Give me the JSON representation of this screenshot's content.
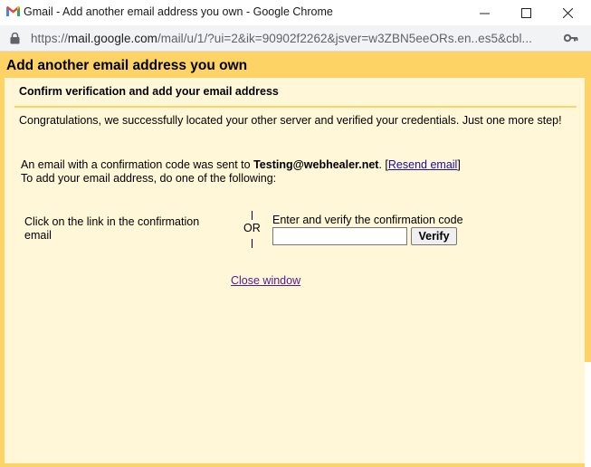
{
  "window": {
    "title": "Gmail - Add another email address you own - Google Chrome",
    "minimize": "—",
    "maximize": "☐",
    "close": "✕"
  },
  "addressbar": {
    "url_prefix": "https://",
    "url_host": "mail.google.com",
    "url_rest": "/mail/u/1/?ui=2&ik=90902f2262&jsver=w3ZBN5eeORs.en..es5&cbl..."
  },
  "page": {
    "title": "Add another email address you own",
    "section_title": "Confirm verification and add your email address",
    "congrats": "Congratulations, we successfully located your other server and verified your credentials. Just one more step!",
    "sent_prefix": "An email with a confirmation code was sent to ",
    "sent_email": "Testing@webhealer.net",
    "sent_suffix": ". [",
    "resend_link": "Resend email",
    "sent_close": "]",
    "todo": "To add your email address, do one of the following:",
    "click_text": "Click on the link in the confirmation email",
    "or_text": "OR",
    "enter_text": "Enter and verify the confirmation code",
    "code_value": "",
    "verify_label": "Verify",
    "close_link": "Close window"
  },
  "colors": {
    "header_bg": "#fcd364",
    "content_bg": "#fff7d7",
    "link": "#1a0dab",
    "visited_link": "#551a8b"
  }
}
